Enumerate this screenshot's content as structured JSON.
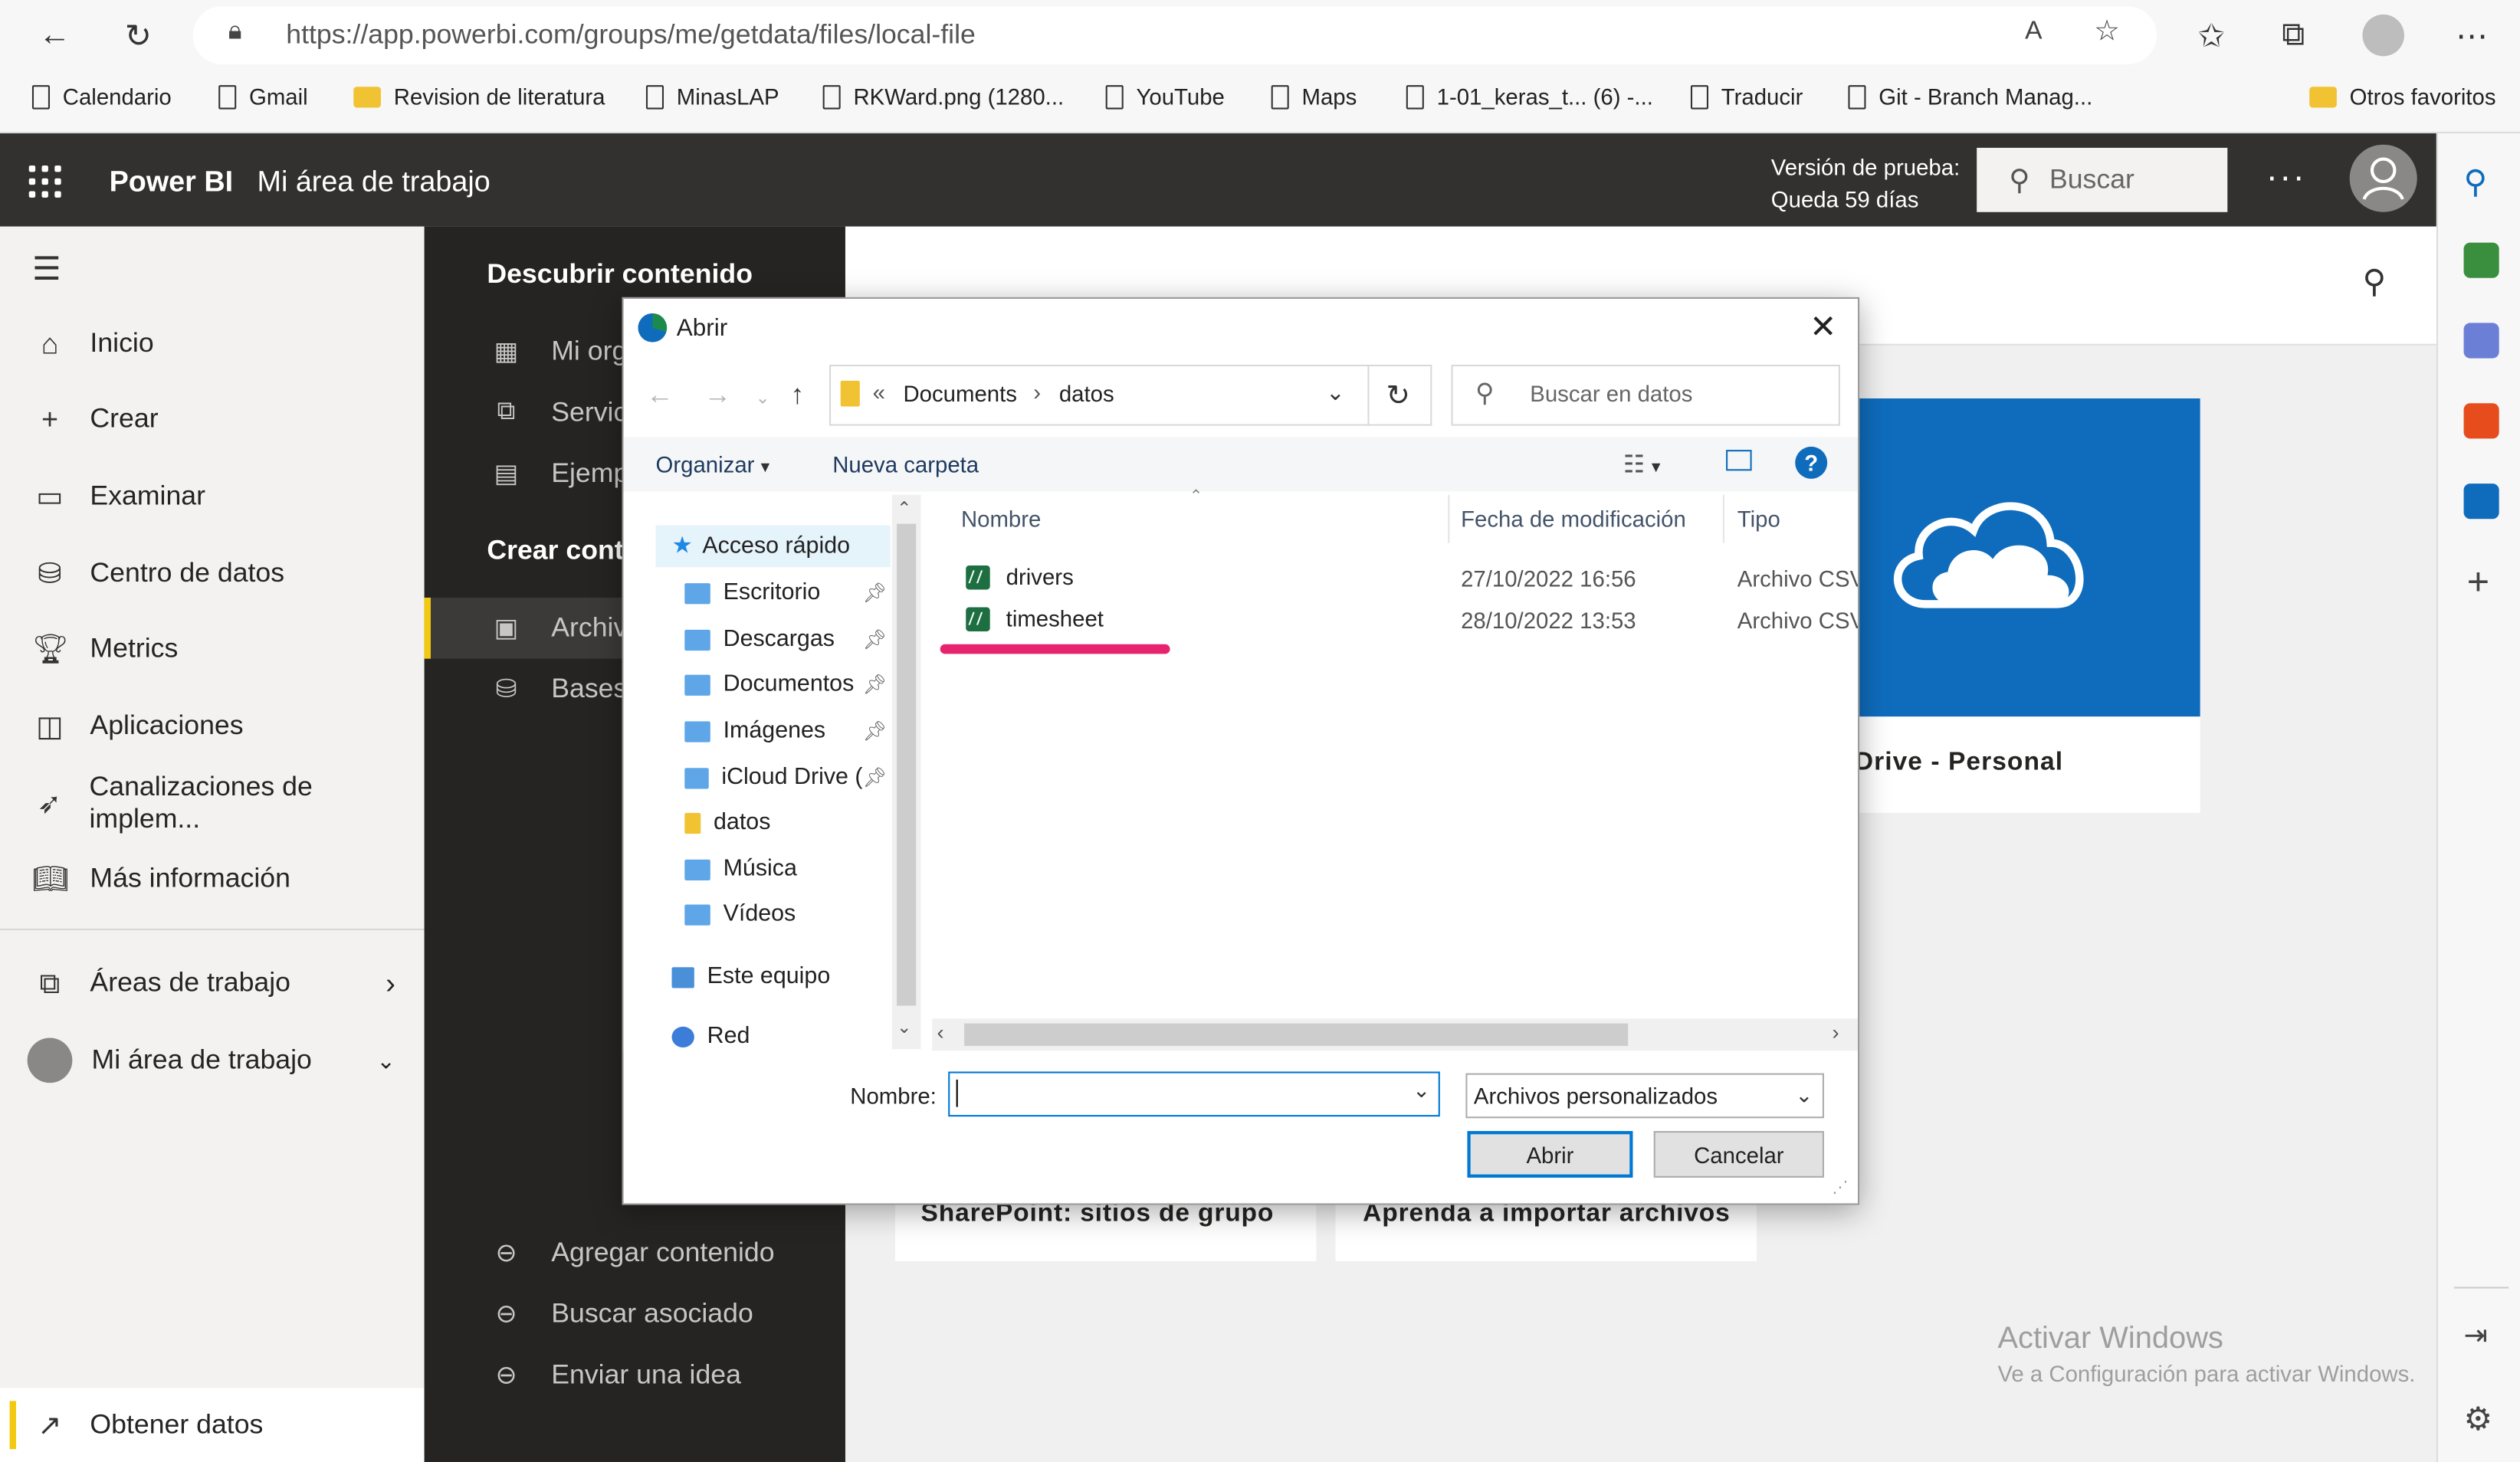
{
  "browser": {
    "url": "https://app.powerbi.com/groups/me/getdata/files/local-file",
    "bookmarks": [
      "Calendario",
      "Gmail",
      "Revision de literatura",
      "MinasLAP",
      "RKWard.png (1280...",
      "YouTube",
      "Maps",
      "1-01_keras_t... (6) -...",
      "Traducir",
      "Git - Branch Manag..."
    ],
    "other_favorites": "Otros favoritos"
  },
  "header": {
    "app_name": "Power BI",
    "workspace": "Mi área de trabajo",
    "trial_line1": "Versión de prueba:",
    "trial_line2": "Queda 59 días",
    "search_placeholder": "Buscar",
    "more": "···"
  },
  "leftnav": {
    "items": [
      "Inicio",
      "Crear",
      "Examinar",
      "Centro de datos",
      "Metrics",
      "Aplicaciones",
      "Canalizaciones de implem...",
      "Más información"
    ],
    "workspaces": "Áreas de trabajo",
    "my_workspace": "Mi área de trabajo",
    "get_data": "Obtener datos"
  },
  "panel": {
    "discover_title": "Descubrir contenido",
    "discover_items": [
      "Mi org",
      "Servic",
      "Ejemp"
    ],
    "create_title": "Crear conte",
    "create_items": [
      "Archiv",
      "Bases"
    ],
    "bottom_items": [
      "Agregar contenido",
      "Buscar asociado",
      "Enviar una idea"
    ]
  },
  "main": {
    "onedrive_title": "Drive - Personal",
    "card_sharepoint": "SharePoint: sitios de grupo",
    "card_learn": "Aprenda a importar archivos",
    "watermark_line1": "Activar Windows",
    "watermark_line2": "Ve a Configuración para activar Windows."
  },
  "dialog": {
    "title": "Abrir",
    "path": [
      "Documents",
      "datos"
    ],
    "search_placeholder": "Buscar en datos",
    "organize": "Organizar",
    "new_folder": "Nueva carpeta",
    "help": "?",
    "tree": {
      "quick_access": "Acceso rápido",
      "items": [
        "Escritorio",
        "Descargas",
        "Documentos",
        "Imágenes",
        "iCloud Drive (",
        "datos",
        "Música",
        "Vídeos"
      ],
      "this_pc": "Este equipo",
      "network": "Red"
    },
    "columns": {
      "name": "Nombre",
      "date": "Fecha de modificación",
      "type": "Tipo"
    },
    "files": [
      {
        "name": "drivers",
        "date": "27/10/2022 16:56",
        "type": "Archivo CSV"
      },
      {
        "name": "timesheet",
        "date": "28/10/2022 13:53",
        "type": "Archivo CSV"
      }
    ],
    "name_label": "Nombre:",
    "name_value": "",
    "filetype": "Archivos personalizados",
    "open_btn": "Abrir",
    "cancel_btn": "Cancelar"
  },
  "colors": {
    "pbi_dark": "#323130",
    "panel": "#252423",
    "accent_yellow": "#f2c811",
    "onedrive_blue": "#0f6cbd",
    "highlight_pink": "#e8236e"
  }
}
